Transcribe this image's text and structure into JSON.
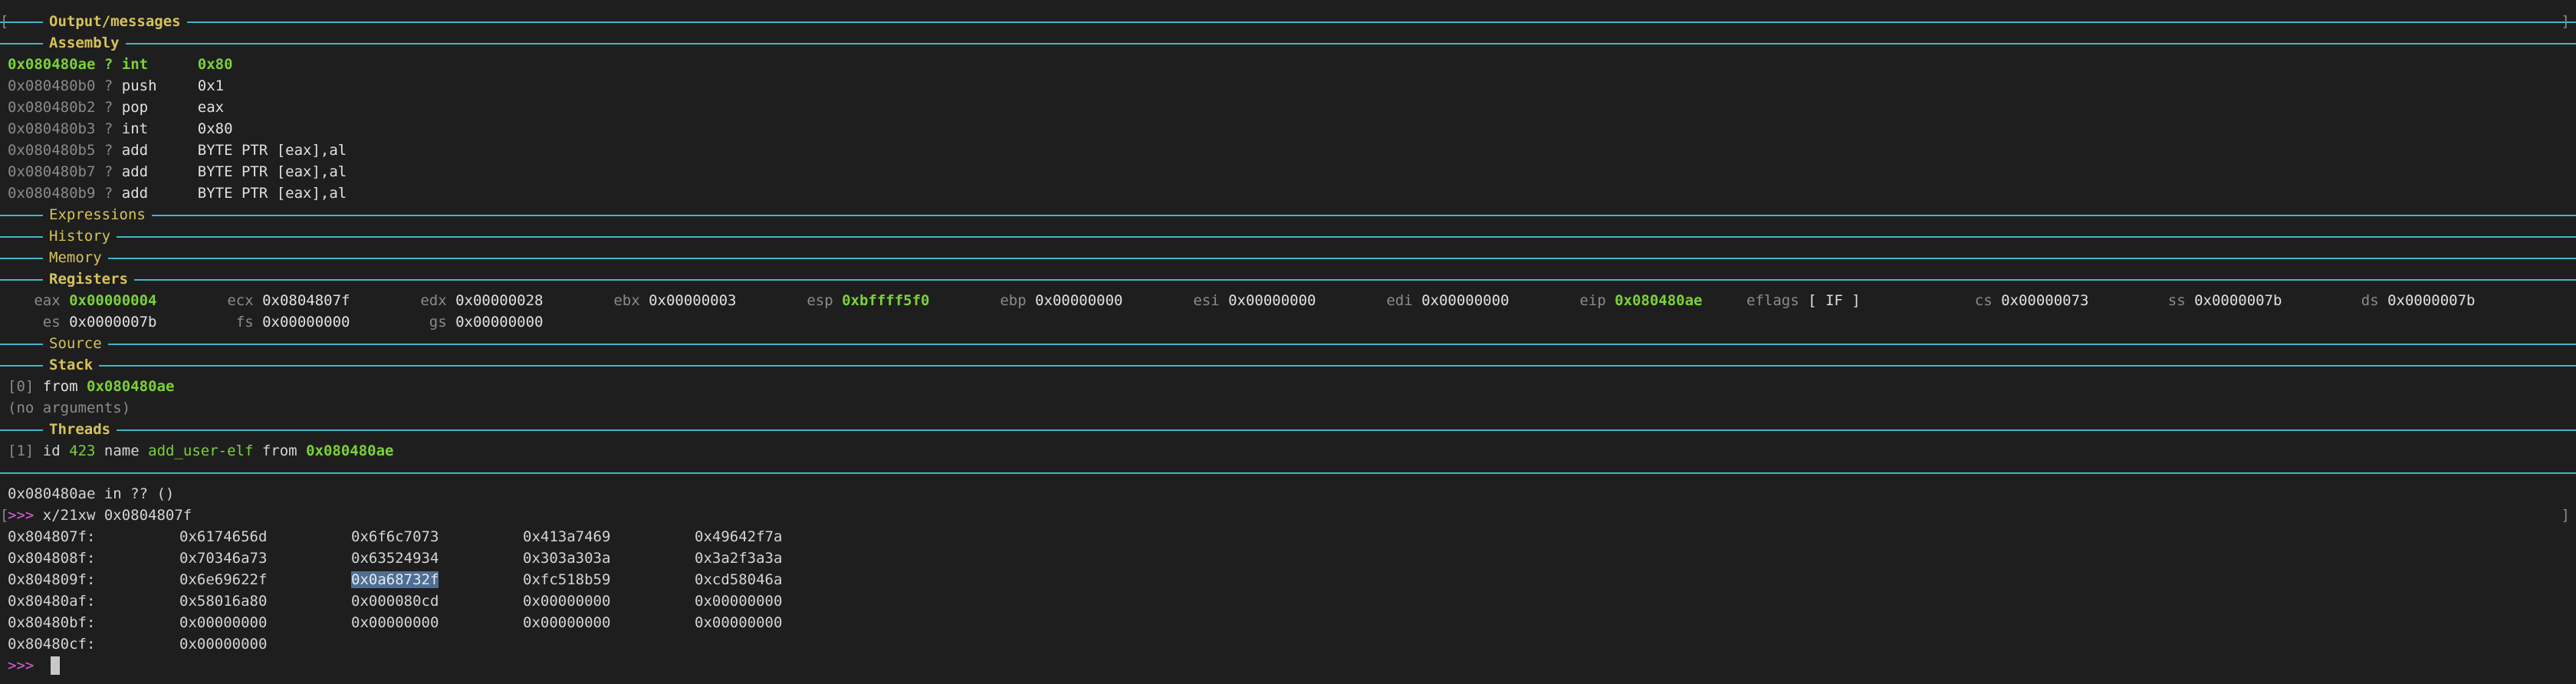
{
  "sections": {
    "output": "Output/messages",
    "assembly": "Assembly",
    "expressions": "Expressions",
    "history": "History",
    "memory": "Memory",
    "registers": "Registers",
    "source": "Source",
    "stack": "Stack",
    "threads": "Threads"
  },
  "assembly": [
    {
      "addr": "0x080480ae",
      "mark": "?",
      "op": "int",
      "arg": "0x80",
      "current": true
    },
    {
      "addr": "0x080480b0",
      "mark": "?",
      "op": "push",
      "arg": "0x1",
      "current": false
    },
    {
      "addr": "0x080480b2",
      "mark": "?",
      "op": "pop",
      "arg": "eax",
      "current": false
    },
    {
      "addr": "0x080480b3",
      "mark": "?",
      "op": "int",
      "arg": "0x80",
      "current": false
    },
    {
      "addr": "0x080480b5",
      "mark": "?",
      "op": "add",
      "arg": "BYTE PTR [eax],al",
      "current": false
    },
    {
      "addr": "0x080480b7",
      "mark": "?",
      "op": "add",
      "arg": "BYTE PTR [eax],al",
      "current": false
    },
    {
      "addr": "0x080480b9",
      "mark": "?",
      "op": "add",
      "arg": "BYTE PTR [eax],al",
      "current": false
    }
  ],
  "registers": {
    "row1": [
      {
        "name": "eax",
        "value": "0x00000004",
        "changed": true
      },
      {
        "name": "ecx",
        "value": "0x0804807f",
        "changed": false
      },
      {
        "name": "edx",
        "value": "0x00000028",
        "changed": false
      },
      {
        "name": "ebx",
        "value": "0x00000003",
        "changed": false
      },
      {
        "name": "esp",
        "value": "0xbffff5f0",
        "changed": true
      },
      {
        "name": "ebp",
        "value": "0x00000000",
        "changed": false
      },
      {
        "name": "esi",
        "value": "0x00000000",
        "changed": false
      },
      {
        "name": "edi",
        "value": "0x00000000",
        "changed": false
      },
      {
        "name": "eip",
        "value": "0x080480ae",
        "changed": true
      },
      {
        "name": "eflags",
        "value": "[ IF ]",
        "changed": false
      },
      {
        "name": "cs",
        "value": "0x00000073",
        "changed": false
      },
      {
        "name": "ss",
        "value": "0x0000007b",
        "changed": false
      },
      {
        "name": "ds",
        "value": "0x0000007b",
        "changed": false
      }
    ],
    "row2": [
      {
        "name": "es",
        "value": "0x0000007b",
        "changed": false
      },
      {
        "name": "fs",
        "value": "0x00000000",
        "changed": false
      },
      {
        "name": "gs",
        "value": "0x00000000",
        "changed": false
      }
    ]
  },
  "stack": {
    "frame_index": "[0]",
    "from_label": "from",
    "address": "0x080480ae",
    "args": "(no arguments)"
  },
  "threads": {
    "index": "[1]",
    "id_label": "id",
    "id": "423",
    "name_label": "name",
    "name": "add_user-elf",
    "from_label": "from",
    "address": "0x080480ae"
  },
  "console": {
    "location": "0x080480ae in ?? ()",
    "prompt": ">>>",
    "command": "x/21xw 0x0804807f",
    "memory_rows": [
      {
        "addr": "0x804807f:",
        "words": [
          "0x6174656d",
          "0x6f6c7073",
          "0x413a7469",
          "0x49642f7a"
        ]
      },
      {
        "addr": "0x804808f:",
        "words": [
          "0x70346a73",
          "0x63524934",
          "0x303a303a",
          "0x3a2f3a3a"
        ]
      },
      {
        "addr": "0x804809f:",
        "words": [
          "0x6e69622f",
          "0x0a68732f",
          "0xfc518b59",
          "0xcd58046a"
        ]
      },
      {
        "addr": "0x80480af:",
        "words": [
          "0x58016a80",
          "0x000080cd",
          "0x00000000",
          "0x00000000"
        ]
      },
      {
        "addr": "0x80480bf:",
        "words": [
          "0x00000000",
          "0x00000000",
          "0x00000000",
          "0x00000000"
        ]
      },
      {
        "addr": "0x80480cf:",
        "words": [
          "0x00000000"
        ]
      }
    ],
    "selected_word": "0x0a68732f",
    "final_prompt": ">>>"
  },
  "colors": {
    "background": "#1e1e1e",
    "rule": "#3fb6c8",
    "section_title": "#d6c25a",
    "highlight": "#7bd13a",
    "prompt": "#d95fd5",
    "selection": "#4d6e96"
  }
}
